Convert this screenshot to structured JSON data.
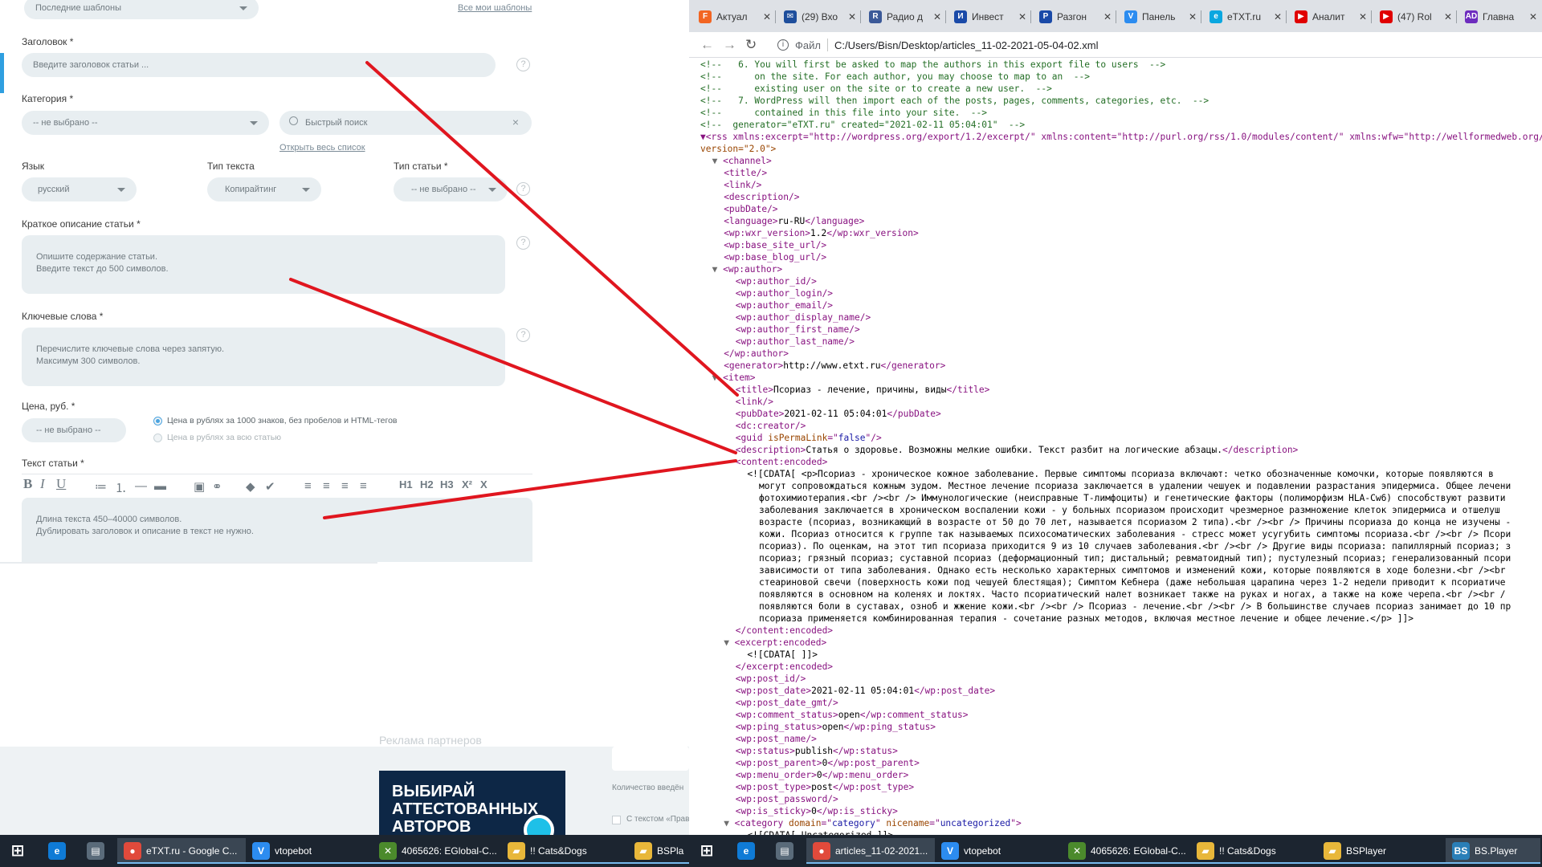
{
  "form": {
    "templates_select": "Последние шаблоны",
    "all_templates_link": "Все мои шаблоны",
    "title_label": "Заголовок",
    "title_placeholder": "Введите заголовок статьи ...",
    "category_label": "Категория",
    "category_select": "-- не выбрано --",
    "quick_search_placeholder": "Быстрый поиск",
    "open_list_link": "Открыть весь список",
    "lang_label": "Язык",
    "lang_value": "русский",
    "text_type_label": "Тип текста",
    "text_type_value": "Копирайтинг",
    "article_type_label": "Тип статьи",
    "article_type_value": "-- не выбрано --",
    "desc_label": "Краткое описание статьи",
    "desc_placeholder_1": "Опишите содержание статьи.",
    "desc_placeholder_2": "Введите текст до 500 символов.",
    "keywords_label": "Ключевые слова",
    "keywords_placeholder_1": "Перечислите ключевые слова через запятую.",
    "keywords_placeholder_2": "Максимум 300 символов.",
    "price_label": "Цена, руб.",
    "price_select": "-- не выбрано --",
    "price_opt1": "Цена в рублях за 1000 знаков, без пробелов и HTML-тегов",
    "price_opt2": "Цена в рублях за всю статью",
    "article_text_label": "Текст статьи",
    "article_text_placeholder_1": "Длина текста 450–40000 символов.",
    "article_text_placeholder_2": "Дублировать заголовок и описание в текст не нужно.",
    "required_mark": "*",
    "help_glyph": "?",
    "toolbar": [
      "B",
      "I",
      "U",
      "≔",
      "⒈",
      "—",
      "▬",
      "▣",
      "⚭",
      "◆",
      "✔",
      "≡",
      "≡",
      "≡",
      "≡",
      "H1",
      "H2",
      "H3",
      "X²",
      "X"
    ],
    "partner_ads": "Реклама партнеров",
    "ad_text_1": "ВЫБИРАЙ",
    "ad_text_2": "АТТЕСТОВАННЫХ",
    "ad_text_3": "АВТОРОВ",
    "count_text": "Количество введён",
    "with_text": "С текстом «Прав"
  },
  "browser": {
    "tabs": [
      {
        "label": "Актуал",
        "icon": "fontawesome-icon",
        "color": "#f26522",
        "glyph": "F"
      },
      {
        "label": "(29) Вхо",
        "icon": "mail-icon",
        "color": "#1e4e9c",
        "glyph": "✉"
      },
      {
        "label": "Радио д",
        "icon": "radio-icon",
        "color": "#3b5998",
        "glyph": "R"
      },
      {
        "label": "Инвест",
        "icon": "invest-icon",
        "color": "#1a4aa8",
        "glyph": "И"
      },
      {
        "label": "Разгон",
        "icon": "razgon-icon",
        "color": "#1a4aa8",
        "glyph": "Р"
      },
      {
        "label": "Панель",
        "icon": "vtope-icon",
        "color": "#2c8cf0",
        "glyph": "V"
      },
      {
        "label": "eTXT.ru",
        "icon": "etxt-icon",
        "color": "#0aa7e0",
        "glyph": "e"
      },
      {
        "label": "Аналит",
        "icon": "youtube-icon",
        "color": "#e00000",
        "glyph": "▶"
      },
      {
        "label": "(47) Rol",
        "icon": "youtube-icon",
        "color": "#e00000",
        "glyph": "▶"
      },
      {
        "label": "Главна",
        "icon": "ad-icon",
        "color": "#6d2cbe",
        "glyph": "AD"
      }
    ],
    "file_label": "Файл",
    "url": "C:/Users/Bisn/Desktop/articles_11-02-2021-05-04-02.xml"
  },
  "xml_lines": [
    {
      "i": 0,
      "t": "c",
      "s": "<!--   6. You will first be asked to map the authors in this export file to users  -->"
    },
    {
      "i": 0,
      "t": "c",
      "s": "<!--      on the site. For each author, you may choose to map to an  -->"
    },
    {
      "i": 0,
      "t": "c",
      "s": "<!--      existing user on the site or to create a new user.  -->"
    },
    {
      "i": 0,
      "t": "c",
      "s": "<!--   7. WordPress will then import each of the posts, pages, comments, categories, etc.  -->"
    },
    {
      "i": 0,
      "t": "c",
      "s": "<!--      contained in this file into your site.  -->"
    },
    {
      "i": 0,
      "t": "c",
      "s": "<!--  generator=\"eTXT.ru\" created=\"2021-02-11 05:04:01\"  -->"
    },
    {
      "i": 0,
      "t": "rss",
      "s": "▼<rss xmlns:excerpt=\"http://wordpress.org/export/1.2/excerpt/\" xmlns:content=\"http://purl.org/rss/1.0/modules/content/\" xmlns:wfw=\"http://wellformedweb.org/CommentAPI/\""
    },
    {
      "i": 0,
      "t": "at",
      "s": "version=\"2.0\">"
    },
    {
      "i": 1,
      "t": "g",
      "s": "▼<channel>"
    },
    {
      "i": 2,
      "t": "g",
      "s": "<title/>"
    },
    {
      "i": 2,
      "t": "g",
      "s": "<link/>"
    },
    {
      "i": 2,
      "t": "g",
      "s": "<description/>"
    },
    {
      "i": 2,
      "t": "g",
      "s": "<pubDate/>"
    },
    {
      "i": 2,
      "t": "e",
      "a": "<language>",
      "b": "ru-RU",
      "c": "</language>"
    },
    {
      "i": 2,
      "t": "e",
      "a": "<wp:wxr_version>",
      "b": "1.2",
      "c": "</wp:wxr_version>"
    },
    {
      "i": 2,
      "t": "g",
      "s": "<wp:base_site_url/>"
    },
    {
      "i": 2,
      "t": "g",
      "s": "<wp:base_blog_url/>"
    },
    {
      "i": 1,
      "t": "g",
      "s": "▼<wp:author>"
    },
    {
      "i": 3,
      "t": "g",
      "s": "<wp:author_id/>"
    },
    {
      "i": 3,
      "t": "g",
      "s": "<wp:author_login/>"
    },
    {
      "i": 3,
      "t": "g",
      "s": "<wp:author_email/>"
    },
    {
      "i": 3,
      "t": "g",
      "s": "<wp:author_display_name/>"
    },
    {
      "i": 3,
      "t": "g",
      "s": "<wp:author_first_name/>"
    },
    {
      "i": 3,
      "t": "g",
      "s": "<wp:author_last_name/>"
    },
    {
      "i": 2,
      "t": "g",
      "s": "</wp:author>"
    },
    {
      "i": 2,
      "t": "e",
      "a": "<generator>",
      "b": "http://www.etxt.ru",
      "c": "</generator>"
    },
    {
      "i": 1,
      "t": "g",
      "s": "▼<item>"
    },
    {
      "i": 3,
      "t": "e",
      "a": "<title>",
      "b": "Псориаз - лечение, причины, виды",
      "c": "</title>"
    },
    {
      "i": 3,
      "t": "g",
      "s": "<link/>"
    },
    {
      "i": 3,
      "t": "e",
      "a": "<pubDate>",
      "b": "2021-02-11 05:04:01",
      "c": "</pubDate>"
    },
    {
      "i": 3,
      "t": "g",
      "s": "<dc:creator/>"
    },
    {
      "i": 3,
      "t": "guid",
      "s": ""
    },
    {
      "i": 3,
      "t": "e",
      "a": "<description>",
      "b": "Статья о здоровье. Возможны мелкие ошибки. Текст разбит на логические абзацы.",
      "c": "</description>"
    },
    {
      "i": 3,
      "t": "g",
      "s": "<content:encoded>"
    },
    {
      "i": 4,
      "t": "x",
      "s": "<![CDATA[ <p>Псориаз - хроническое кожное заболевание. Первые симптомы псориаза включают: четко обозначенные комочки, которые появляются в"
    },
    {
      "i": 5,
      "t": "x",
      "s": "могут сопровождаться кожным зудом. Местное лечение псориаза заключается в удалении чешуек и подавлении разрастания эпидермиса. Общее лечени"
    },
    {
      "i": 5,
      "t": "x",
      "s": "фотохимиотерапия.<br /><br /> Иммунологические (неисправные Т-лимфоциты) и генетические факторы (полиморфизм HLA-Cw6) способствуют развити"
    },
    {
      "i": 5,
      "t": "x",
      "s": "заболевания заключается в хроническом воспалении кожи - у больных псориазом происходит чрезмерное размножение клеток эпидермиса и отшелуш"
    },
    {
      "i": 5,
      "t": "x",
      "s": "возрасте (псориаз, возникающий в возрасте от 50 до 70 лет, называется псориазом 2 типа).<br /><br /> Причины псориаза до конца не изучены -"
    },
    {
      "i": 5,
      "t": "x",
      "s": "кожи. Псориаз относится к группе так называемых психосоматических заболевания - стресс может усугубить симптомы псориаза.<br /><br /> Псори"
    },
    {
      "i": 5,
      "t": "x",
      "s": "псориаз). По оценкам, на этот тип псориаза приходится 9 из 10 случаев заболевания.<br /><br /> Другие виды псориаза: папиллярный псориаз; з"
    },
    {
      "i": 5,
      "t": "x",
      "s": "псориаз; грязный псориаз; суставной псориаз (деформационный тип; дистальный; ревматоидный тип); пустулезный псориаз; генерализованный псори"
    },
    {
      "i": 5,
      "t": "x",
      "s": "зависимости от типа заболевания. Однако есть несколько характерных симптомов и изменений кожи, которые появляются в ходе болезни.<br /><br"
    },
    {
      "i": 5,
      "t": "x",
      "s": "стеариновой свечи (поверхность кожи под чешуей блестящая); Симптом Кебнера (даже небольшая царапина через 1-2 недели приводит к псориатиче"
    },
    {
      "i": 5,
      "t": "x",
      "s": "появляются в основном на коленях и локтях. Часто псориатический налет возникает также на руках и ногах, а также на коже черепа.<br /><br /"
    },
    {
      "i": 5,
      "t": "x",
      "s": "появляются боли в суставах, озноб и жжение кожи.<br /><br /> Псориаз - лечение.<br /><br /> В большинстве случаев псориаз занимает до 10 пр"
    },
    {
      "i": 5,
      "t": "x",
      "s": "псориаза применяется комбинированная терапия - сочетание разных методов, включая местное лечение и общее лечение.</p> ]]>"
    },
    {
      "i": 3,
      "t": "g",
      "s": "</content:encoded>"
    },
    {
      "i": 2,
      "t": "g",
      "s": "▼<excerpt:encoded>"
    },
    {
      "i": 4,
      "t": "x",
      "s": "<![CDATA[ ]]>"
    },
    {
      "i": 3,
      "t": "g",
      "s": "</excerpt:encoded>"
    },
    {
      "i": 3,
      "t": "g",
      "s": "<wp:post_id/>"
    },
    {
      "i": 3,
      "t": "e",
      "a": "<wp:post_date>",
      "b": "2021-02-11 05:04:01",
      "c": "</wp:post_date>"
    },
    {
      "i": 3,
      "t": "g",
      "s": "<wp:post_date_gmt/>"
    },
    {
      "i": 3,
      "t": "e",
      "a": "<wp:comment_status>",
      "b": "open",
      "c": "</wp:comment_status>"
    },
    {
      "i": 3,
      "t": "e",
      "a": "<wp:ping_status>",
      "b": "open",
      "c": "</wp:ping_status>"
    },
    {
      "i": 3,
      "t": "g",
      "s": "<wp:post_name/>"
    },
    {
      "i": 3,
      "t": "e",
      "a": "<wp:status>",
      "b": "publish",
      "c": "</wp:status>"
    },
    {
      "i": 3,
      "t": "e",
      "a": "<wp:post_parent>",
      "b": "0",
      "c": "</wp:post_parent>"
    },
    {
      "i": 3,
      "t": "e",
      "a": "<wp:menu_order>",
      "b": "0",
      "c": "</wp:menu_order>"
    },
    {
      "i": 3,
      "t": "e",
      "a": "<wp:post_type>",
      "b": "post",
      "c": "</wp:post_type>"
    },
    {
      "i": 3,
      "t": "g",
      "s": "<wp:post_password/>"
    },
    {
      "i": 3,
      "t": "e",
      "a": "<wp:is_sticky>",
      "b": "0",
      "c": "</wp:is_sticky>"
    },
    {
      "i": 2,
      "t": "cat",
      "s": ""
    },
    {
      "i": 4,
      "t": "x",
      "s": "<![CDATA[ Uncategorized ]]>"
    }
  ],
  "guid_parts": {
    "a": "<guid ",
    "b": "isPermaLink",
    "c": "=\"",
    "d": "false",
    "e": "\"/>"
  },
  "cat_parts": {
    "a": "▼<category ",
    "b": "domain",
    "c": "=\"",
    "d": "category",
    "e": "\" ",
    "f": "nicename",
    "g": "=\"",
    "h": "uncategorized",
    "i": "\">"
  },
  "taskbar": {
    "left": [
      {
        "label": "",
        "icon": "start-icon",
        "glyph": "⊞",
        "color": "transparent"
      },
      {
        "label": "",
        "icon": "edge-icon",
        "glyph": "e",
        "color": "#0f7bd6"
      },
      {
        "label": "",
        "icon": "calculator-icon",
        "glyph": "▤",
        "color": "#5a6b7a"
      },
      {
        "label": "eTXT.ru - Google C...",
        "icon": "chrome-icon",
        "glyph": "●",
        "color": "#e14a3b",
        "active": true
      },
      {
        "label": "vtopebot",
        "icon": "vtope-icon",
        "glyph": "V",
        "color": "#2c8cf0"
      },
      {
        "label": "4065626: EGlobal-C...",
        "icon": "terminal-icon",
        "glyph": "✕",
        "color": "#4b8a2c"
      },
      {
        "label": "!! Cats&Dogs",
        "icon": "folder-icon",
        "glyph": "▰",
        "color": "#e8b73a"
      },
      {
        "label": "BSPla",
        "icon": "folder-icon",
        "glyph": "▰",
        "color": "#e8b73a"
      }
    ],
    "right": [
      {
        "label": "",
        "icon": "start-icon",
        "glyph": "⊞",
        "color": "transparent"
      },
      {
        "label": "",
        "icon": "edge-icon",
        "glyph": "e",
        "color": "#0f7bd6"
      },
      {
        "label": "",
        "icon": "calculator-icon",
        "glyph": "▤",
        "color": "#5a6b7a"
      },
      {
        "label": "articles_11-02-2021...",
        "icon": "chrome-icon",
        "glyph": "●",
        "color": "#e14a3b",
        "active": true
      },
      {
        "label": "vtopebot",
        "icon": "vtope-icon",
        "glyph": "V",
        "color": "#2c8cf0"
      },
      {
        "label": "4065626: EGlobal-C...",
        "icon": "terminal-icon",
        "glyph": "✕",
        "color": "#4b8a2c"
      },
      {
        "label": "!! Cats&Dogs",
        "icon": "folder-icon",
        "glyph": "▰",
        "color": "#e8b73a"
      },
      {
        "label": "BSPlayer",
        "icon": "folder-icon",
        "glyph": "▰",
        "color": "#e8b73a"
      },
      {
        "label": "BS.Player",
        "icon": "bsplayer-icon",
        "glyph": "BS",
        "color": "#2a7fb8",
        "active": true
      }
    ]
  },
  "colors": {
    "annotation_red": "#e0161f"
  }
}
